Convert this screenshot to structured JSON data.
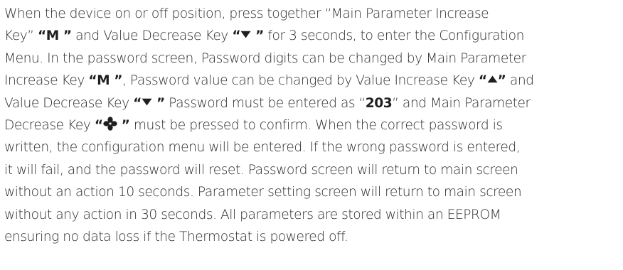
{
  "paragraph": {
    "l1": "When the device on or off position, press together “Main Parameter Increase",
    "l2_a": "Key” ",
    "l2_b": "“M ”",
    "l2_c": " and Value Decrease Key ",
    "l2_d": "“",
    "l2_e": " ”",
    "l2_f": " for 3 seconds, to enter the Configuration",
    "l3": "Menu. In the password screen, Password digits can be changed by Main Parameter",
    "l4_a": "Increase Key ",
    "l4_b": "“M ”",
    "l4_c": ", Password value can be changed by Value Increase Key ",
    "l4_d": "“",
    "l4_e": "”",
    "l4_f": " and",
    "l5_a": "Value Decrease Key ",
    "l5_b": "“",
    "l5_c": " ”",
    "l5_d": " Password must be entered as “",
    "l5_e": "203",
    "l5_f": "” and Main Parameter",
    "l6_a": "Decrease Key ",
    "l6_b": "“",
    "l6_c": " ”",
    "l6_d": " must be pressed to confirm. When the correct password is",
    "l7": "written, the configuration menu will be entered. If the wrong password is entered,",
    "l8": "it will fail, and the password will reset. Password screen will return to main screen",
    "l9": "without an action 10 seconds. Parameter setting screen will return to main screen",
    "l10": "without any action in 30 seconds. All parameters are stored within an EEPROM",
    "l11": "ensuring no data loss if the Thermostat is powered off."
  },
  "icons": {
    "value_decrease": "triangle-down-icon",
    "value_increase": "triangle-up-icon",
    "main_parameter_decrease": "fan-icon"
  }
}
